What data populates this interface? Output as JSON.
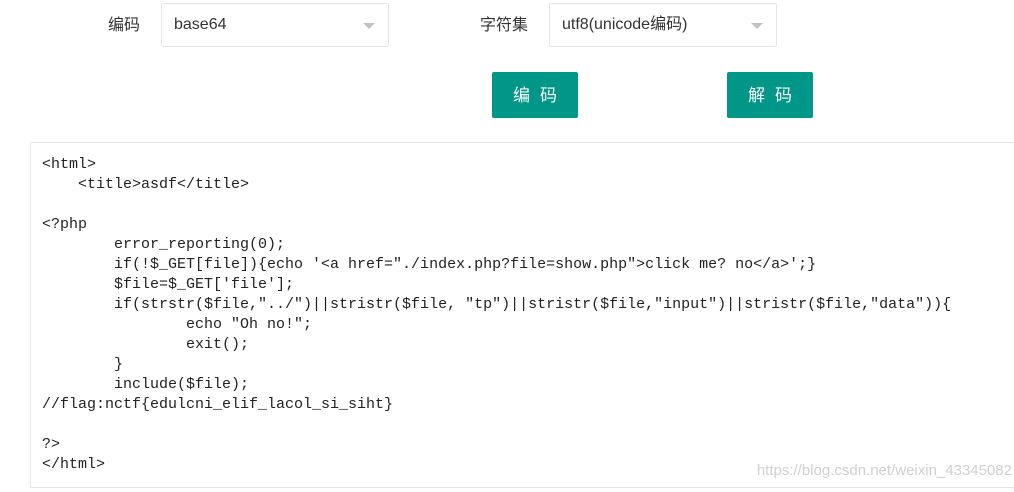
{
  "encoding_row": {
    "label": "编码",
    "selected": "base64"
  },
  "charset_row": {
    "label": "字符集",
    "selected": "utf8(unicode编码)"
  },
  "buttons": {
    "encode_label": "编码",
    "decode_label": "解码"
  },
  "editor": {
    "content": "<html>\n    <title>asdf</title>\n\n<?php\n        error_reporting(0);\n        if(!$_GET[file]){echo '<a href=\"./index.php?file=show.php\">click me? no</a>';}\n        $file=$_GET['file'];\n        if(strstr($file,\"../\")||stristr($file, \"tp\")||stristr($file,\"input\")||stristr($file,\"data\")){\n                echo \"Oh no!\";\n                exit();\n        }\n        include($file);\n//flag:nctf{edulcni_elif_lacol_si_siht}\n\n?>\n</html>"
  },
  "watermark": "https://blog.csdn.net/weixin_43345082",
  "icons": {
    "select_arrow": "chevron-down-icon"
  },
  "colors": {
    "button": "#009688",
    "border": "#e6e6e6"
  }
}
